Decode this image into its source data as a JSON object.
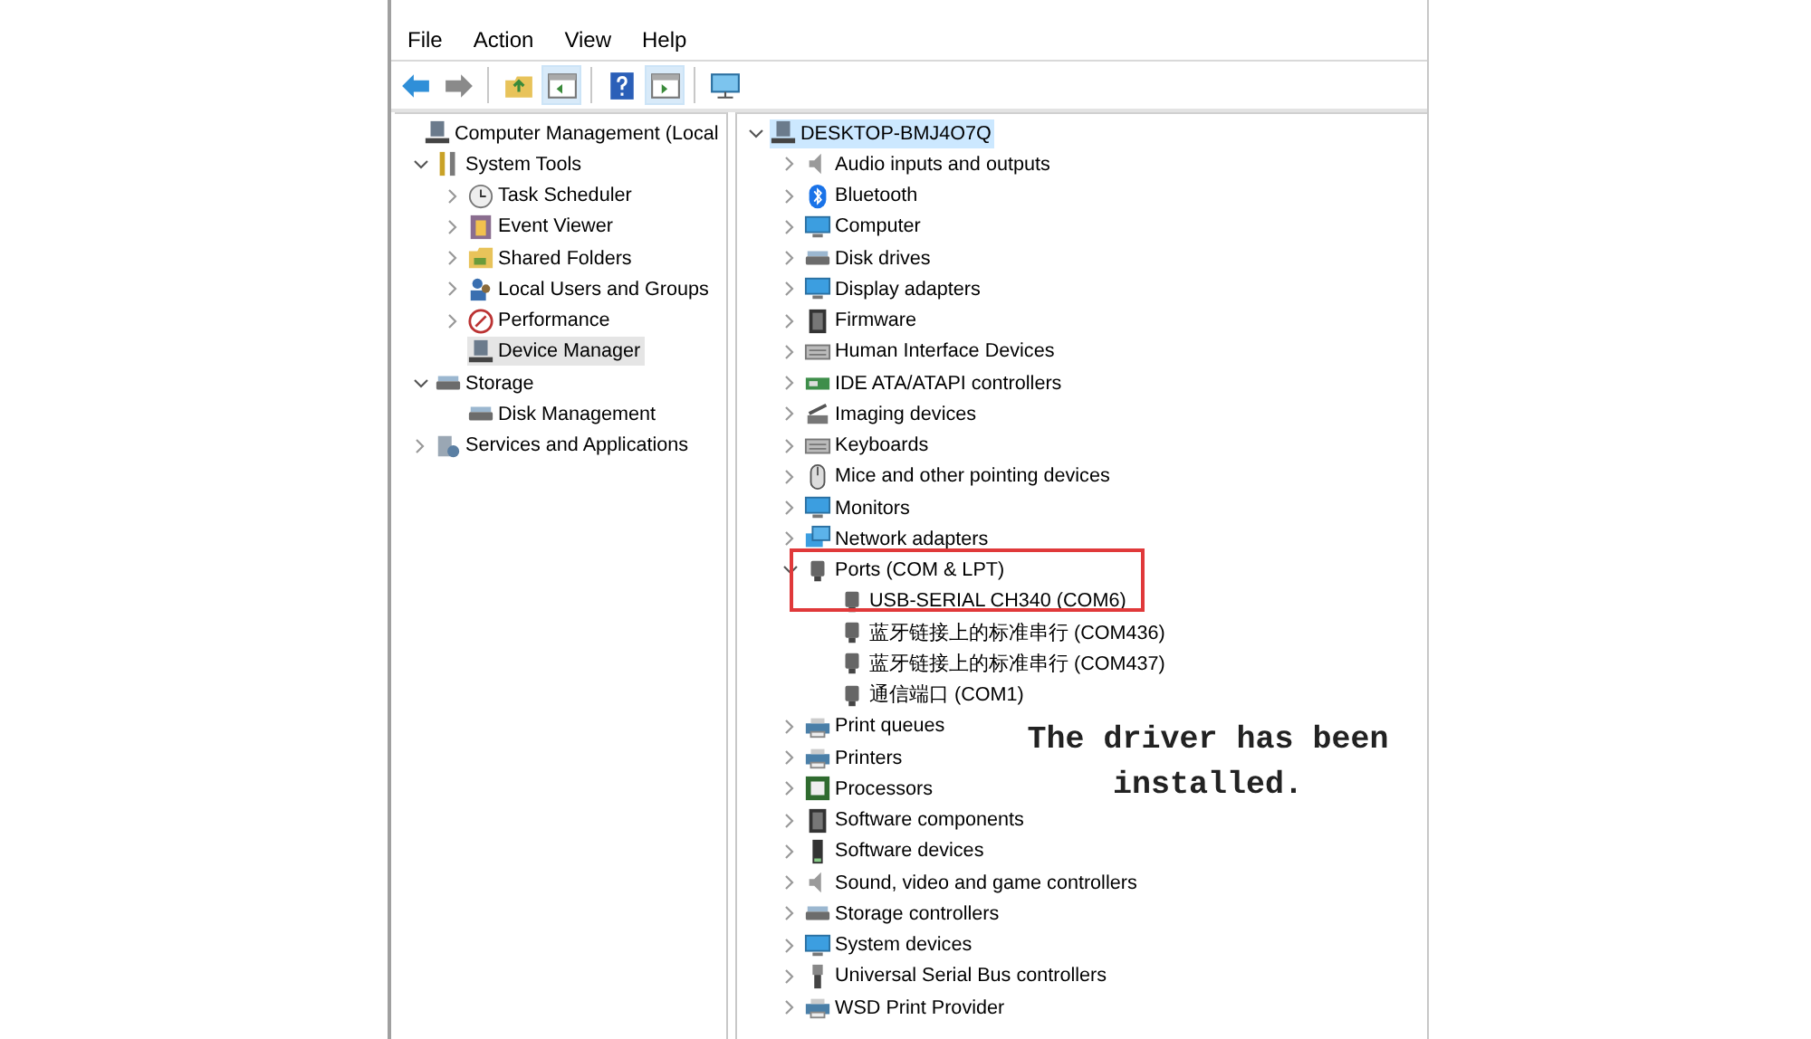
{
  "menu": [
    "File",
    "Action",
    "View",
    "Help"
  ],
  "toolbar": [
    {
      "pressed": false
    },
    {
      "pressed": false
    },
    {
      "pressed": false
    },
    {
      "pressed": true
    },
    {
      "pressed": false
    },
    {
      "pressed": true
    },
    {
      "pressed": false
    }
  ],
  "navigation_tree": {
    "items": [
      {
        "label": "Computer Management (Local",
        "selected": false,
        "children": [
          {
            "label": "System Tools",
            "selected": false,
            "expanded": true,
            "children": [
              {
                "label": "Task Scheduler",
                "selected": false,
                "expanded": false
              },
              {
                "label": "Event Viewer",
                "selected": false,
                "expanded": false
              },
              {
                "label": "Shared Folders",
                "selected": false,
                "expanded": false
              },
              {
                "label": "Local Users and Groups",
                "selected": false,
                "expanded": false
              },
              {
                "label": "Performance",
                "selected": false,
                "expanded": false
              },
              {
                "label": "Device Manager",
                "selected": true
              }
            ]
          },
          {
            "label": "Storage",
            "selected": false,
            "expanded": true,
            "children": [
              {
                "label": "Disk Management",
                "selected": false
              }
            ]
          },
          {
            "label": "Services and Applications",
            "selected": false,
            "expanded": false
          }
        ]
      }
    ]
  },
  "device_tree": {
    "items": [
      {
        "label": "DESKTOP-BMJ4O7Q",
        "selected": true,
        "expanded": true,
        "children": [
          {
            "label": "Audio inputs and outputs",
            "selected": false,
            "expanded": false
          },
          {
            "label": "Bluetooth",
            "selected": false,
            "expanded": false
          },
          {
            "label": "Computer",
            "selected": false,
            "expanded": false
          },
          {
            "label": "Disk drives",
            "selected": false,
            "expanded": false
          },
          {
            "label": "Display adapters",
            "selected": false,
            "expanded": false
          },
          {
            "label": "Firmware",
            "selected": false,
            "expanded": false
          },
          {
            "label": "Human Interface Devices",
            "selected": false,
            "expanded": false
          },
          {
            "label": "IDE ATA/ATAPI controllers",
            "selected": false,
            "expanded": false
          },
          {
            "label": "Imaging devices",
            "selected": false,
            "expanded": false
          },
          {
            "label": "Keyboards",
            "selected": false,
            "expanded": false
          },
          {
            "label": "Mice and other pointing devices",
            "selected": false,
            "expanded": false
          },
          {
            "label": "Monitors",
            "selected": false,
            "expanded": false
          },
          {
            "label": "Network adapters",
            "selected": false,
            "expanded": false
          },
          {
            "label": "Ports (COM & LPT)",
            "selected": false,
            "expanded": true,
            "children": [
              {
                "label": "USB-SERIAL CH340 (COM6)",
                "selected": false
              },
              {
                "label": "蓝牙链接上的标准串行 (COM436)",
                "selected": false
              },
              {
                "label": "蓝牙链接上的标准串行 (COM437)",
                "selected": false
              },
              {
                "label": "通信端口 (COM1)",
                "selected": false
              }
            ]
          },
          {
            "label": "Print queues",
            "selected": false,
            "expanded": false
          },
          {
            "label": "Printers",
            "selected": false,
            "expanded": false
          },
          {
            "label": "Processors",
            "selected": false,
            "expanded": false
          },
          {
            "label": "Software components",
            "selected": false,
            "expanded": false
          },
          {
            "label": "Software devices",
            "selected": false,
            "expanded": false
          },
          {
            "label": "Sound, video and game controllers",
            "selected": false,
            "expanded": false
          },
          {
            "label": "Storage controllers",
            "selected": false,
            "expanded": false
          },
          {
            "label": "System devices",
            "selected": false,
            "expanded": false
          },
          {
            "label": "Universal Serial Bus controllers",
            "selected": false,
            "expanded": false
          },
          {
            "label": "WSD Print Provider",
            "selected": false,
            "expanded": false
          }
        ]
      }
    ]
  },
  "annotation": {
    "text": "The driver has been installed."
  }
}
